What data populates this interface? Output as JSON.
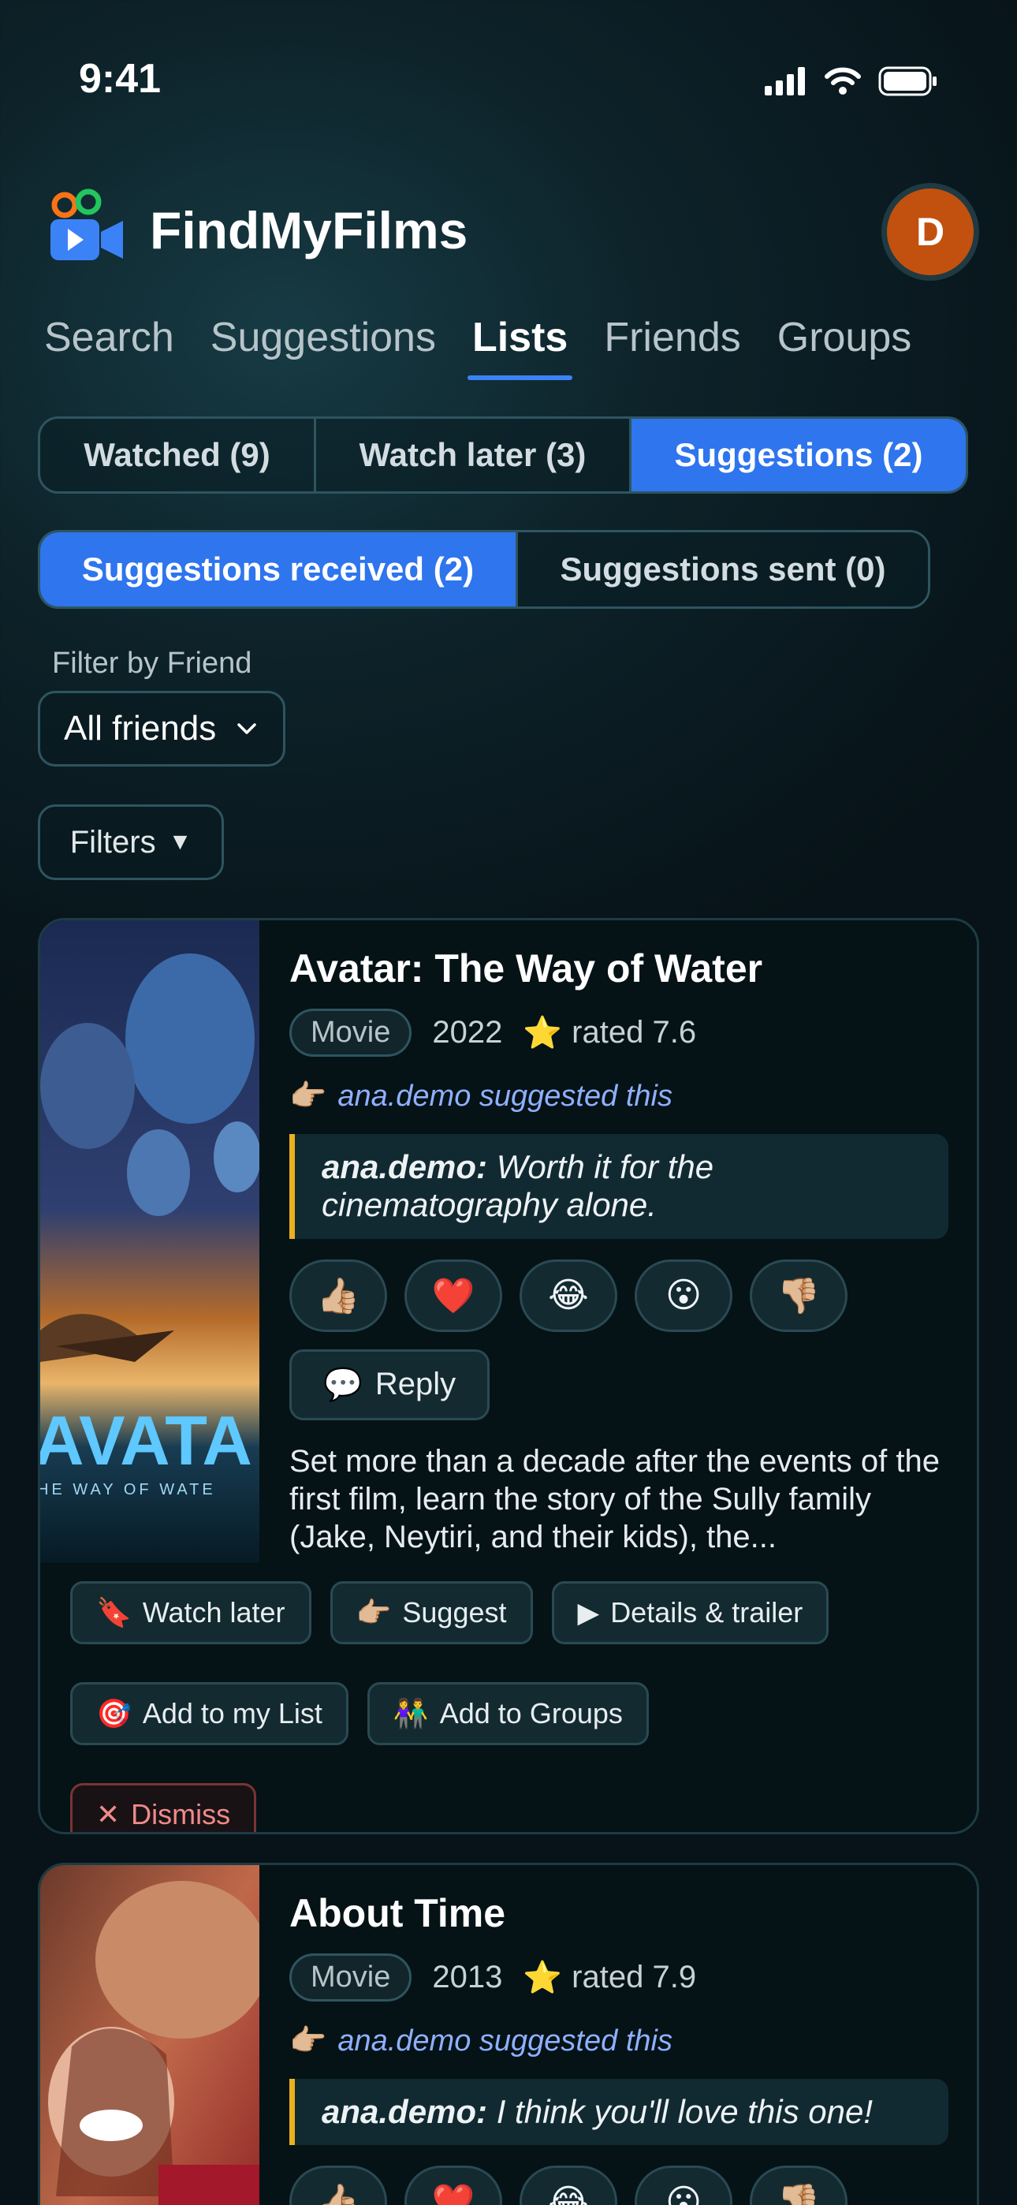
{
  "status_bar": {
    "time": "9:41"
  },
  "app": {
    "title": "FindMyFilms",
    "avatar_initial": "D"
  },
  "nav": {
    "items": [
      {
        "label": "Search",
        "active": false
      },
      {
        "label": "Suggestions",
        "active": false
      },
      {
        "label": "Lists",
        "active": true
      },
      {
        "label": "Friends",
        "active": false
      },
      {
        "label": "Groups",
        "active": false
      }
    ]
  },
  "list_tabs": [
    {
      "label": "Watched (9)",
      "active": false
    },
    {
      "label": "Watch later (3)",
      "active": false
    },
    {
      "label": "Suggestions (2)",
      "active": true
    }
  ],
  "suggestion_tabs": [
    {
      "label": "Suggestions received (2)",
      "active": true
    },
    {
      "label": "Suggestions sent (0)",
      "active": false
    }
  ],
  "filter": {
    "label": "Filter by Friend",
    "selected": "All friends",
    "filters_button": "Filters"
  },
  "cards": [
    {
      "title": "Avatar: The Way of Water",
      "type": "Movie",
      "year": "2022",
      "rating": "rated 7.6",
      "suggested_by": "ana.demo suggested this",
      "quote_author": "ana.demo:",
      "quote_text": "Worth it for the cinematography alone.",
      "reactions": [
        "👍🏼",
        "❤️",
        "😂",
        "😮",
        "👎🏼"
      ],
      "reply_label": "Reply",
      "synopsis": "Set more than a decade after the events of the first film, learn the story of the Sully family (Jake, Neytiri, and their kids), the...",
      "poster_text": "AVATA",
      "poster_subtext": "HE WAY OF WATE",
      "actions": {
        "watch_later": "Watch later",
        "suggest": "Suggest",
        "details": "Details & trailer",
        "add_list": "Add to my List",
        "add_groups": "Add to Groups",
        "dismiss": "Dismiss"
      }
    },
    {
      "title": "About Time",
      "type": "Movie",
      "year": "2013",
      "rating": "rated 7.9",
      "suggested_by": "ana.demo suggested this",
      "quote_author": "ana.demo:",
      "quote_text": "I think you'll love this one!",
      "reactions": [
        "👍🏼",
        "❤️",
        "😂",
        "😮",
        "👎🏼"
      ]
    }
  ],
  "colors": {
    "accent": "#2e75ee",
    "avatar": "#c2510f",
    "quote_bar": "#e9b01f",
    "link": "#8fb0ff"
  }
}
